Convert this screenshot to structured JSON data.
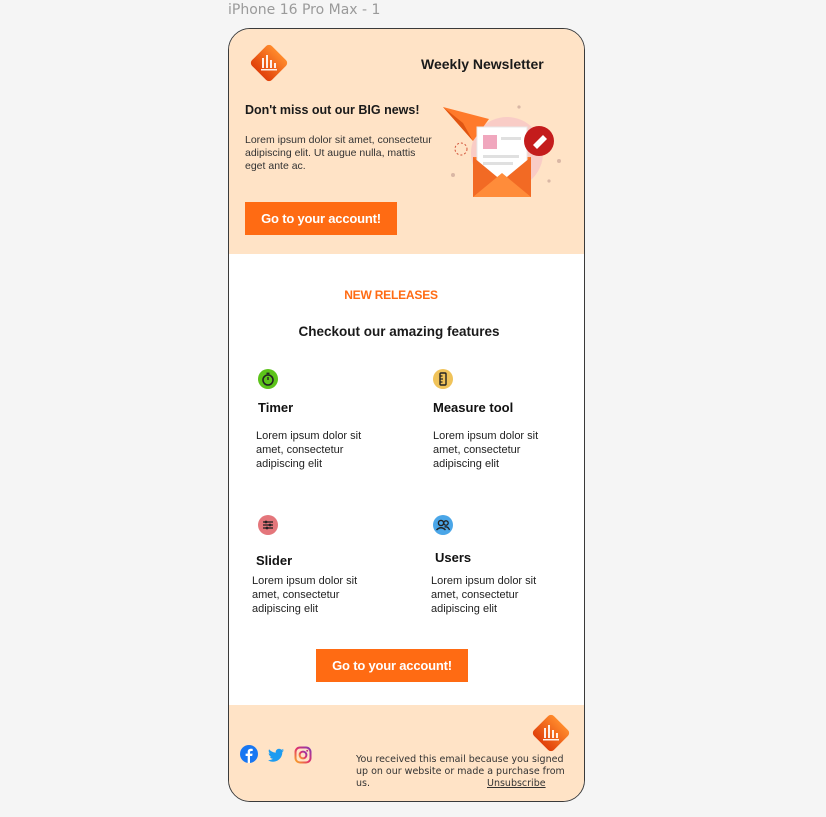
{
  "frame_label": "iPhone 16 Pro Max - 1",
  "colors": {
    "accent": "#ff6b13",
    "header_bg": "#ffe3c6",
    "body_bg": "#ffffff"
  },
  "header": {
    "title": "Weekly Newsletter",
    "heading": "Don't miss out our BIG news!",
    "body": "Lorem ipsum dolor sit amet, consectetur adipiscing elit. Ut augue nulla, mattis eget ante ac.",
    "cta_label": "Go to your account!",
    "illustration": "envelope-paper-plane-illustration"
  },
  "releases": {
    "eyebrow": "NEW RELEASES",
    "title": "Checkout our amazing features",
    "features": [
      {
        "icon": "timer-icon",
        "name": "Timer",
        "description": "Lorem ipsum dolor sit amet, consectetur adipiscing elit"
      },
      {
        "icon": "ruler-icon",
        "name": "Measure tool",
        "description": "Lorem ipsum dolor sit amet, consectetur adipiscing elit"
      },
      {
        "icon": "sliders-icon",
        "name": "Slider",
        "description": "Lorem ipsum dolor sit amet, consectetur adipiscing elit"
      },
      {
        "icon": "users-icon",
        "name": "Users",
        "description": "Lorem ipsum dolor sit amet, consectetur adipiscing elit"
      }
    ],
    "cta_label": "Go to your account!"
  },
  "footer": {
    "social": [
      "facebook-icon",
      "twitter-icon",
      "instagram-icon"
    ],
    "legal_text": "You received this email because you signed up on our website or made a purchase from us.",
    "unsubscribe_label": "Unsubscribe"
  }
}
